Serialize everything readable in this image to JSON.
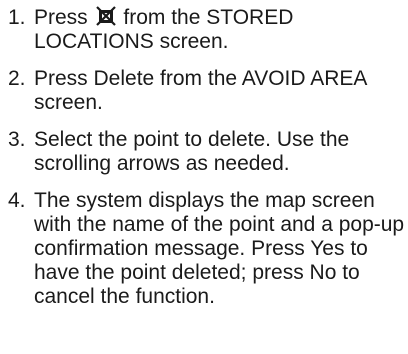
{
  "steps": [
    {
      "number": "1.",
      "before_icon": "Press",
      "icon": "avoid-area-icon",
      "after_icon": "from the STORED LOCATIONS screen."
    },
    {
      "number": "2.",
      "text": "Press Delete from the AVOID AREA screen."
    },
    {
      "number": "3.",
      "text": "Select the point to delete. Use the scrolling arrows as needed."
    },
    {
      "number": "4.",
      "text": "The system displays the map screen with the name of the point and a pop-up confirmation message. Press Yes to have the point deleted; press No to cancel the function."
    }
  ]
}
